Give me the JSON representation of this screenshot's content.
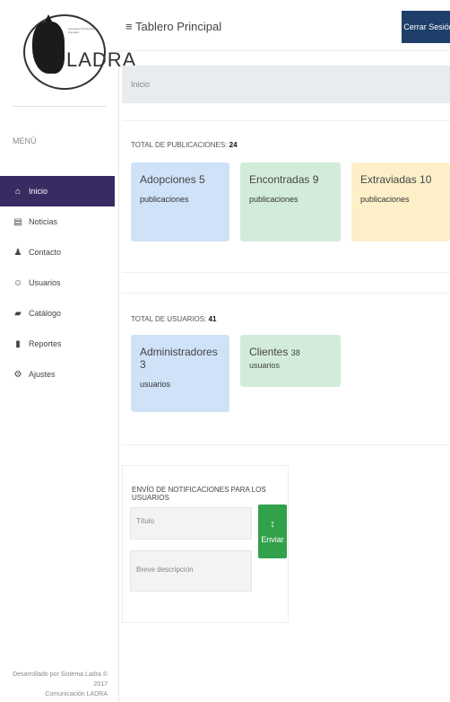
{
  "brand": {
    "name": "LADRA",
    "subtitle": "Asociación Protectora de Animales"
  },
  "sidebar": {
    "menu_title": "MENÚ",
    "items": [
      {
        "label": "Inicio",
        "icon": "home-icon",
        "glyph": "⌂",
        "active": true
      },
      {
        "label": "Noticias",
        "icon": "news-icon",
        "glyph": "▤",
        "active": false
      },
      {
        "label": "Contacto",
        "icon": "person-icon",
        "glyph": "♟",
        "active": false
      },
      {
        "label": "Usuarios",
        "icon": "users-icon",
        "glyph": "☺",
        "active": false
      },
      {
        "label": "Catálogo",
        "icon": "folder-icon",
        "glyph": "▰",
        "active": false
      },
      {
        "label": "Reportes",
        "icon": "report-icon",
        "glyph": "▮",
        "active": false
      },
      {
        "label": "Ajustes",
        "icon": "settings-icon",
        "glyph": "⚙",
        "active": false
      }
    ],
    "footer_line1": "Desarrollado por Sistema Ladra © 2017",
    "footer_line2": "Comunicación LADRA"
  },
  "header": {
    "title": "Tablero Principal",
    "menu_icon": "≡",
    "logout_label": "Cerrar Sesión"
  },
  "breadcrumb": {
    "text": "Inicio"
  },
  "publications": {
    "label": "TOTAL DE PUBLICACIONES:",
    "total": "24",
    "cards": [
      {
        "title": "Adopciones 5",
        "sub": "publicaciones",
        "color": "#cfe2f8"
      },
      {
        "title": "Encontradas 9",
        "sub": "publicaciones",
        "color": "#d3ecd9"
      },
      {
        "title": "Extraviadas 10",
        "sub": "publicaciones",
        "color": "#fdf0c8"
      }
    ]
  },
  "users": {
    "label": "TOTAL DE USUARIOS:",
    "total": "41",
    "cards": [
      {
        "title": "Administradores 3",
        "sub": "usuarios",
        "color": "#cfe2f8"
      },
      {
        "title": "Clientes",
        "sub": "38 usuarios",
        "color": "#d3ecd9"
      }
    ]
  },
  "notify": {
    "title": "ENVÍO DE NOTIFICACIONES PARA LOS USUARIOS",
    "title_placeholder": "Título",
    "desc_placeholder": "Breve descripción",
    "send_label": "Enviar",
    "send_icon": "↕"
  },
  "colors": {
    "active_nav": "#372b62",
    "logout": "#1f3f6b",
    "send": "#31a14b"
  }
}
